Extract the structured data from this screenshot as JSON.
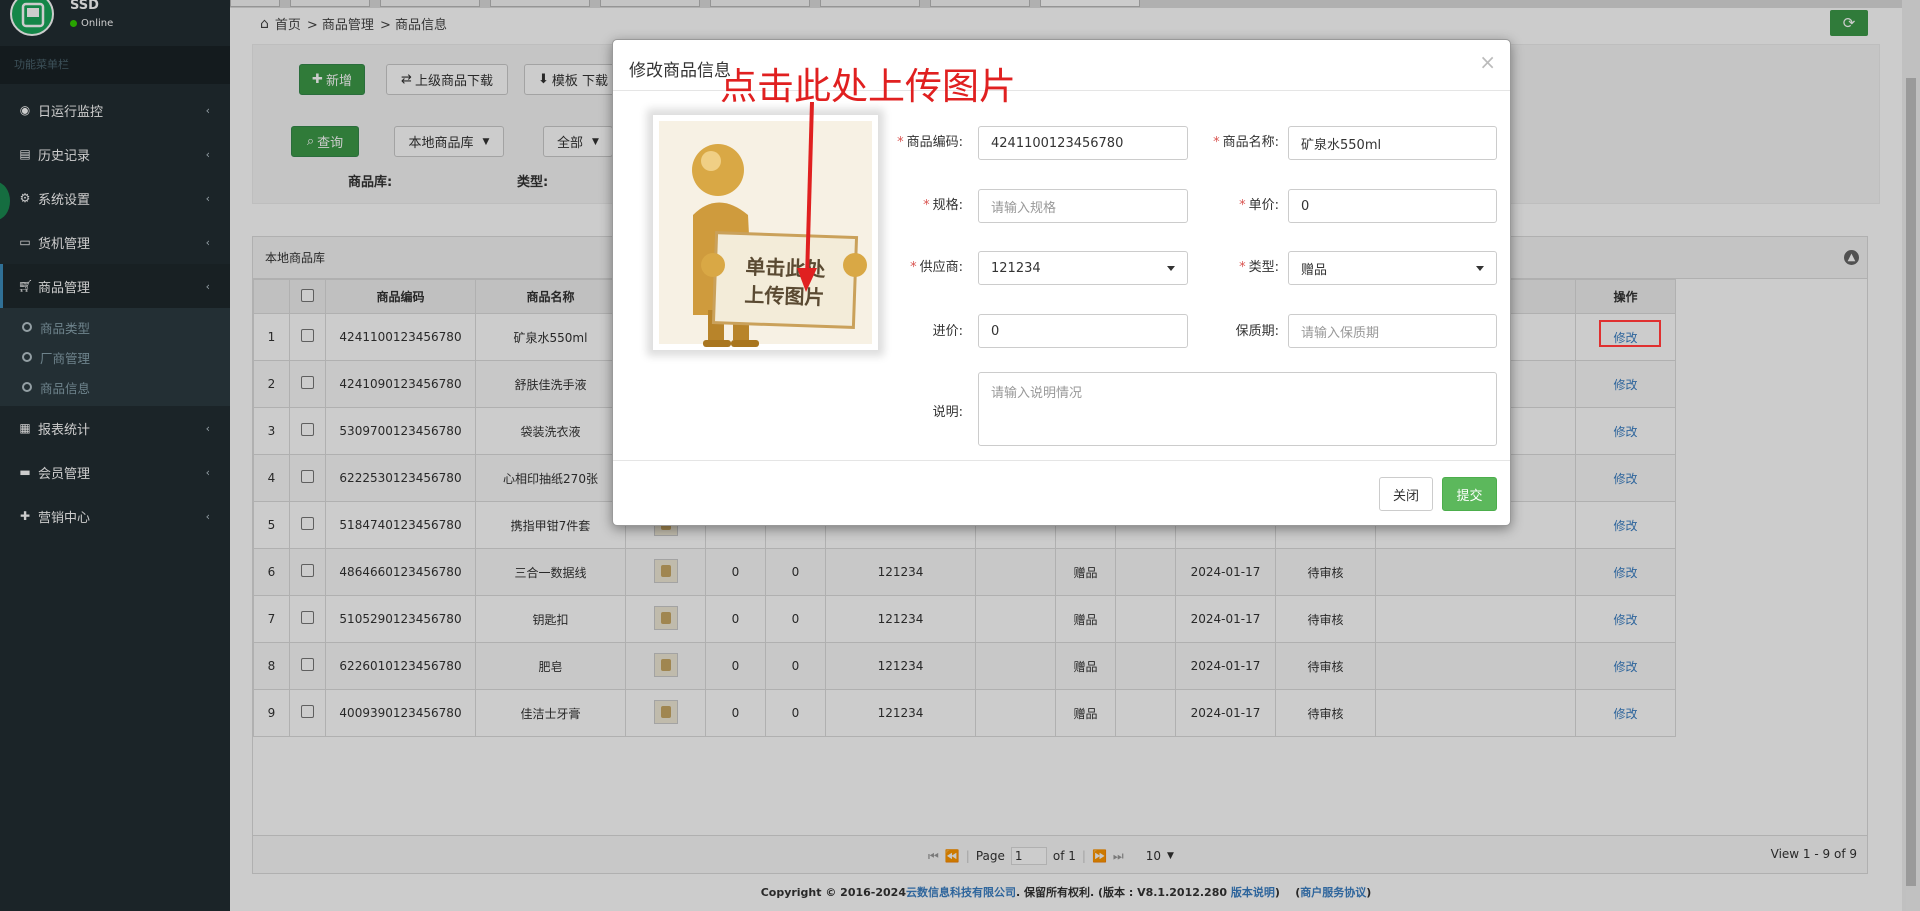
{
  "sidebar": {
    "user_name": "SSD",
    "status": "Online",
    "header": "功能菜单栏",
    "menu": [
      {
        "label": "日运行监控",
        "icon": "eye-icon"
      },
      {
        "label": "历史记录",
        "icon": "book-icon"
      },
      {
        "label": "系统设置",
        "icon": "gear-icon"
      },
      {
        "label": "货机管理",
        "icon": "laptop-icon"
      },
      {
        "label": "商品管理",
        "icon": "cart-icon"
      },
      {
        "label": "报表统计",
        "icon": "table-icon"
      },
      {
        "label": "会员管理",
        "icon": "card-icon"
      },
      {
        "label": "营销中心",
        "icon": "gift-icon"
      }
    ],
    "submenu": [
      "商品类型",
      "厂商管理",
      "商品信息"
    ]
  },
  "breadcrumb": {
    "home": "首页",
    "level1": "> 商品管理",
    "level2": "> 商品信息"
  },
  "toolbar": {
    "add": "新增",
    "download_parent": "上级商品下载",
    "template_download": "模板 下载",
    "query": "查询",
    "library_select": "本地商品库",
    "all_select": "全部",
    "library_label": "商品库:",
    "type_label": "类型:"
  },
  "grid": {
    "title": "本地商品库",
    "headers": {
      "code": "商品编码",
      "name": "商品名称",
      "op": "操作"
    },
    "rows": [
      {
        "no": "1",
        "code": "4241100123456780",
        "name": "矿泉水550ml",
        "a": "",
        "b": "",
        "supplier": "",
        "type": "",
        "date": "",
        "status": "",
        "op": "修改"
      },
      {
        "no": "2",
        "code": "4241090123456780",
        "name": "舒肤佳洗手液",
        "a": "",
        "b": "",
        "supplier": "",
        "type": "",
        "date": "",
        "status": "",
        "op": "修改"
      },
      {
        "no": "3",
        "code": "5309700123456780",
        "name": "袋装洗衣液",
        "a": "",
        "b": "",
        "supplier": "",
        "type": "",
        "date": "",
        "status": "",
        "op": "修改"
      },
      {
        "no": "4",
        "code": "6222530123456780",
        "name": "心相印抽纸270张",
        "a": "",
        "b": "",
        "supplier": "",
        "type": "",
        "date": "",
        "status": "",
        "op": "修改"
      },
      {
        "no": "5",
        "code": "5184740123456780",
        "name": "携指甲钳7件套",
        "a": "",
        "b": "",
        "supplier": "",
        "type": "",
        "date": "",
        "status": "",
        "op": "修改"
      },
      {
        "no": "6",
        "code": "4864660123456780",
        "name": "三合一数据线",
        "a": "0",
        "b": "0",
        "supplier": "121234",
        "type": "赠品",
        "date": "2024-01-17",
        "status": "待审核",
        "op": "修改"
      },
      {
        "no": "7",
        "code": "5105290123456780",
        "name": "钥匙扣",
        "a": "0",
        "b": "0",
        "supplier": "121234",
        "type": "赠品",
        "date": "2024-01-17",
        "status": "待审核",
        "op": "修改"
      },
      {
        "no": "8",
        "code": "6226010123456780",
        "name": "肥皂",
        "a": "0",
        "b": "0",
        "supplier": "121234",
        "type": "赠品",
        "date": "2024-01-17",
        "status": "待审核",
        "op": "修改"
      },
      {
        "no": "9",
        "code": "4009390123456780",
        "name": "佳洁士牙膏",
        "a": "0",
        "b": "0",
        "supplier": "121234",
        "type": "赠品",
        "date": "2024-01-17",
        "status": "待审核",
        "op": "修改"
      }
    ]
  },
  "pager": {
    "page_label": "Page",
    "page": "1",
    "of": "of 1",
    "size": "10",
    "view": "View 1 - 9 of 9"
  },
  "footer": {
    "copyright": "Copyright © 2016-2024",
    "company": "云数信息科技有限公司",
    "rights": ". 保留所有权利.  (版本 : V8.1.2012.280",
    "version_link": "版本说明",
    "close_paren": ")",
    "agreement_open": "(",
    "agreement_link": "商户服务协议",
    "agreement_close": ")"
  },
  "modal": {
    "title": "修改商品信息",
    "annotation": "点击此处上传图片",
    "photo_text": "单击此处上传图片",
    "fields": {
      "code": {
        "label": "商品编码:",
        "value": "4241100123456780"
      },
      "name": {
        "label": "商品名称:",
        "value": "矿泉水550ml"
      },
      "spec": {
        "label": "规格:",
        "placeholder": "请输入规格"
      },
      "price": {
        "label": "单价:",
        "value": "0"
      },
      "supplier": {
        "label": "供应商:",
        "value": "121234"
      },
      "type": {
        "label": "类型:",
        "value": "赠品"
      },
      "cost": {
        "label": "进价:",
        "value": "0"
      },
      "shelf": {
        "label": "保质期:",
        "placeholder": "请输入保质期"
      },
      "desc": {
        "label": "说明:",
        "placeholder": "请输入说明情况"
      }
    },
    "close": "关闭",
    "submit": "提交"
  },
  "colors": {
    "accent_green": "#5cb85c",
    "annotation_red": "#e02020",
    "sidebar_bg": "#222d32",
    "link_blue": "#3a7fc4"
  }
}
